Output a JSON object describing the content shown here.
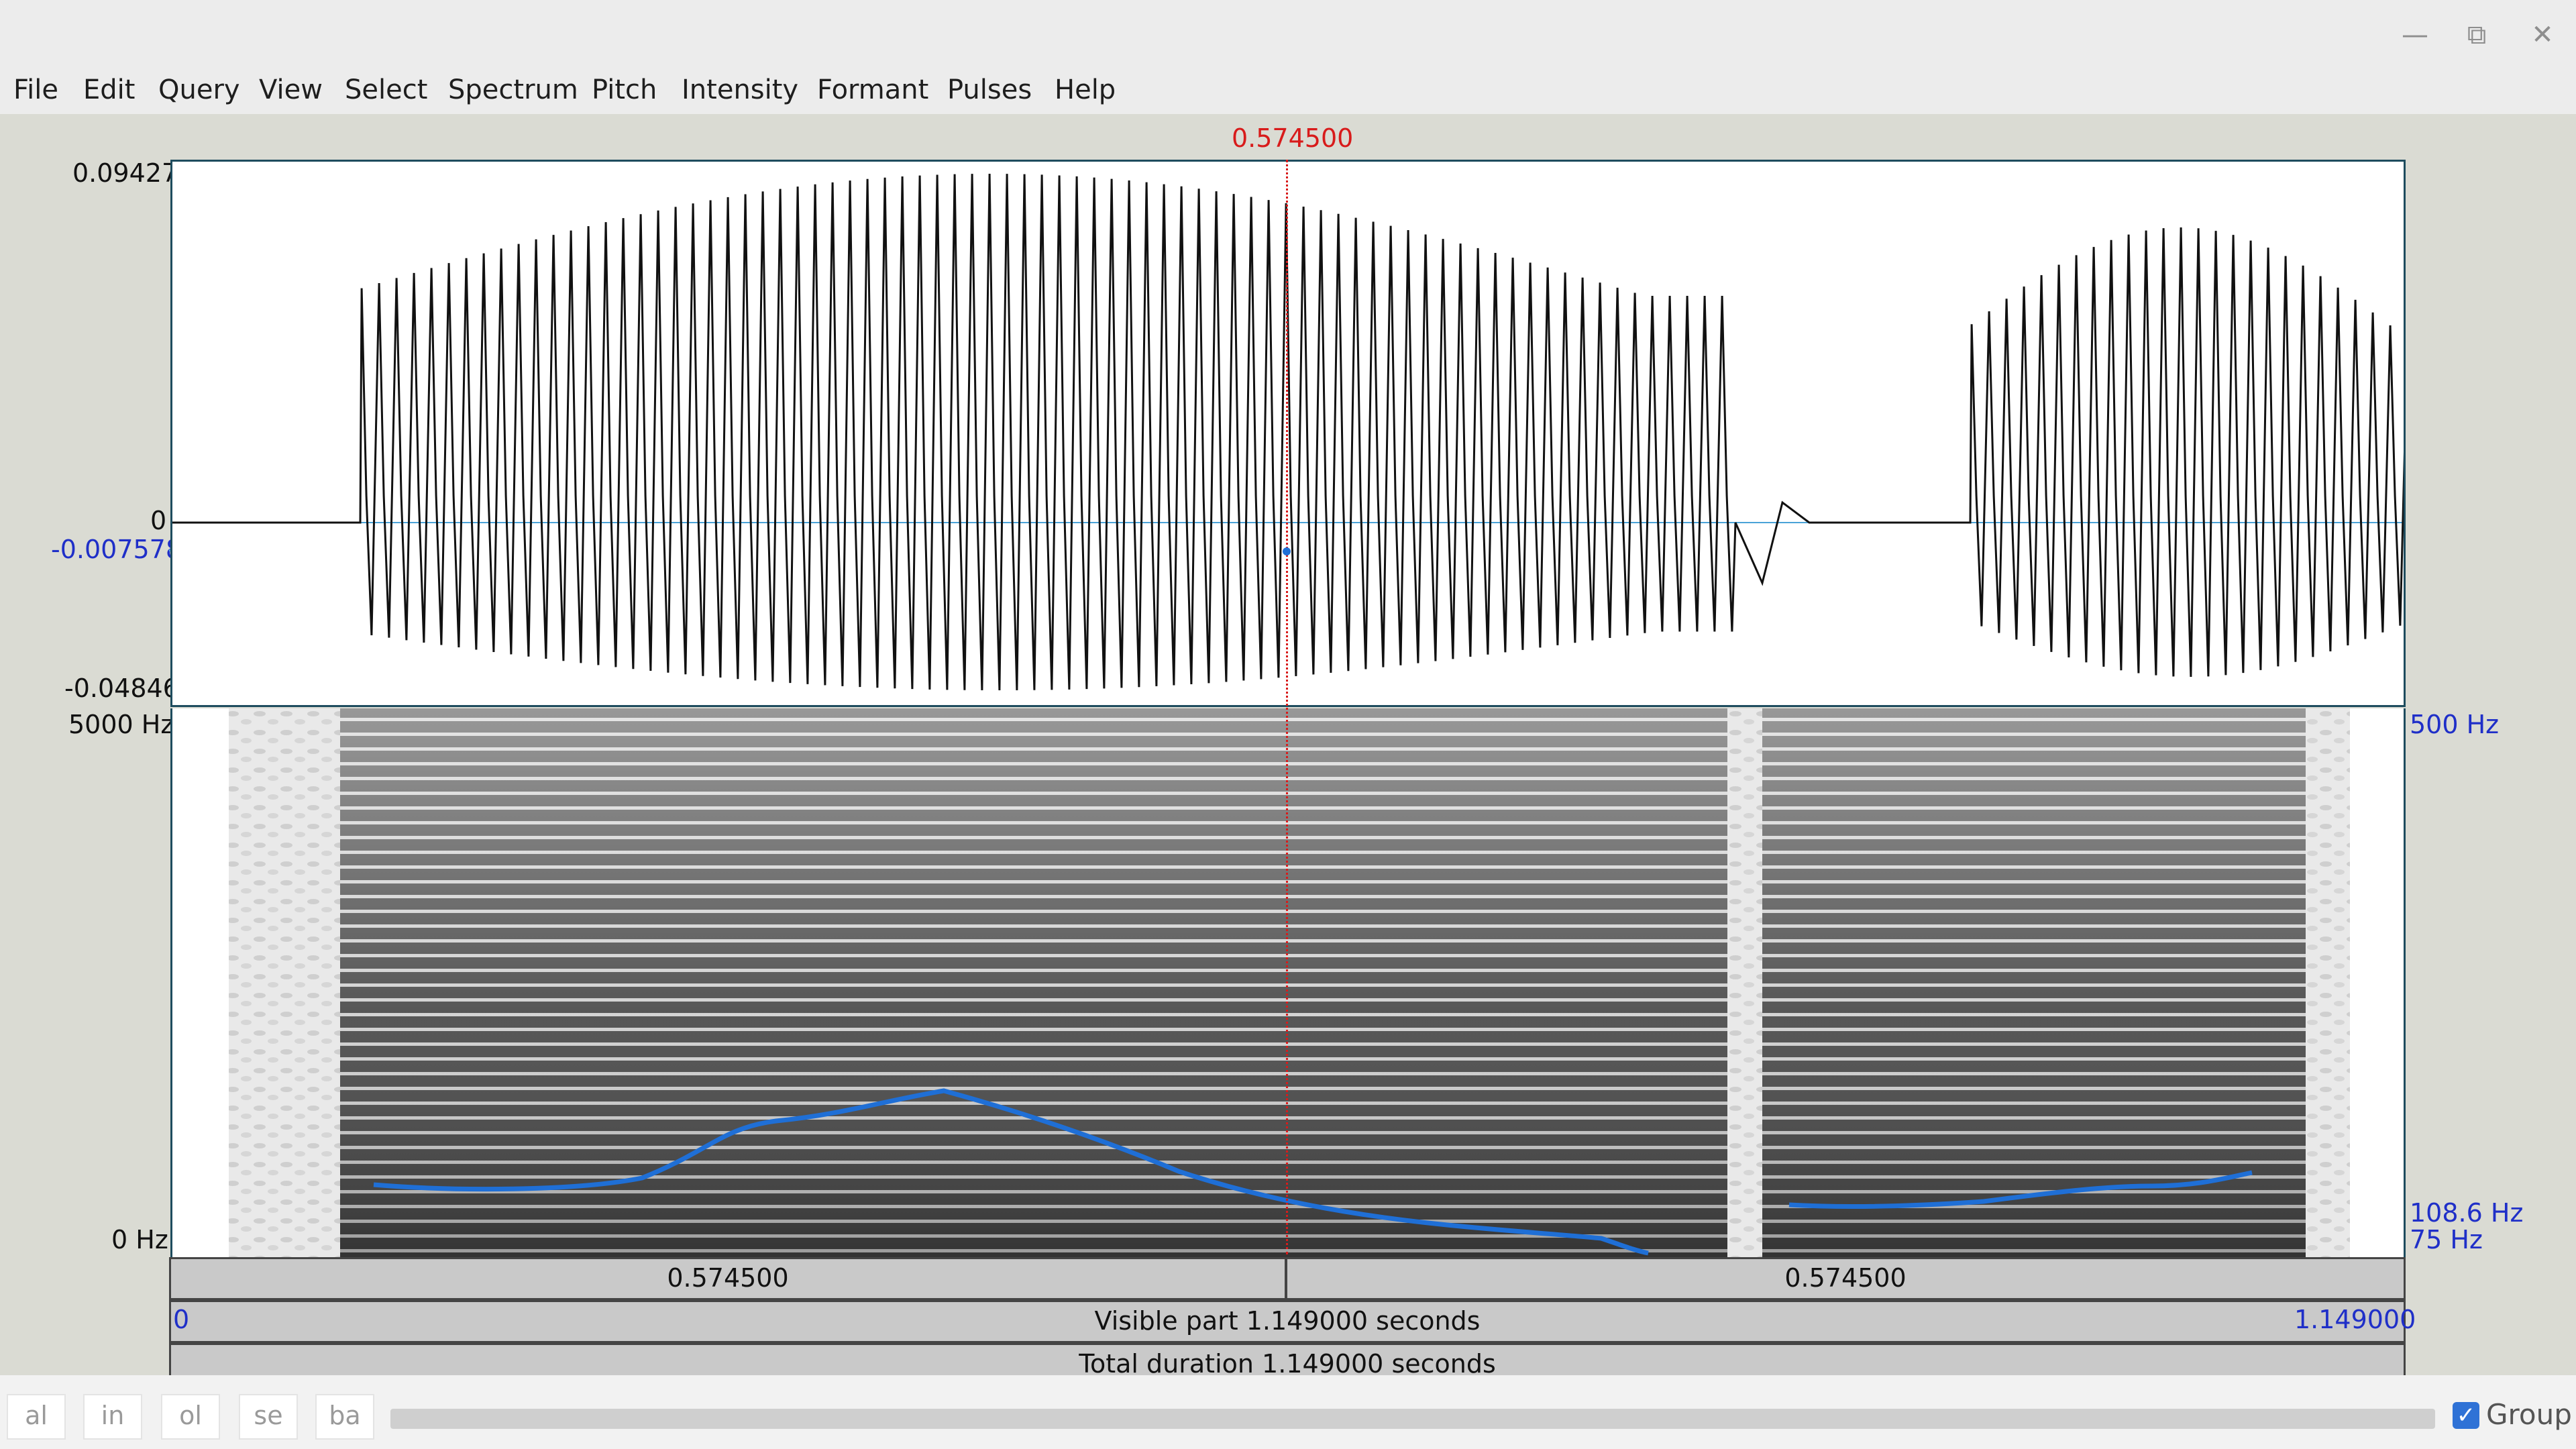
{
  "window": {
    "controls": [
      "minimize-icon",
      "maximize-icon",
      "close-icon"
    ]
  },
  "menu": [
    "File",
    "Edit",
    "Query",
    "View",
    "Select",
    "Spectrum",
    "Pitch",
    "Intensity",
    "Formant",
    "Pulses",
    "Help"
  ],
  "cursor": {
    "time_label": "0.574500",
    "value_label": "-0.007578"
  },
  "waveform": {
    "max_label": "0.09427",
    "zero_label": "0",
    "min_label": "-0.04846"
  },
  "spectrogram": {
    "top_freq_label": "5000 Hz",
    "bottom_freq_label": "0 Hz"
  },
  "pitch": {
    "top_label": "500 Hz",
    "current_label": "108.6 Hz",
    "bottom_label": "75 Hz"
  },
  "time_bars": {
    "left_segment": "0.574500",
    "right_segment": "0.574500",
    "visible_start": "0",
    "visible_label": "Visible part 1.149000 seconds",
    "visible_end": "1.149000",
    "total_label": "Total duration 1.149000 seconds"
  },
  "bottom": {
    "zoom_buttons": [
      "al",
      "in",
      "ol",
      "se",
      "ba"
    ],
    "group_label": "Group",
    "group_checked": true
  },
  "colors": {
    "cursor": "#d81b1b",
    "pitch_curve": "#1f6fd6",
    "label_blue": "#1f2fc8",
    "workarea": "#dadbd3"
  }
}
